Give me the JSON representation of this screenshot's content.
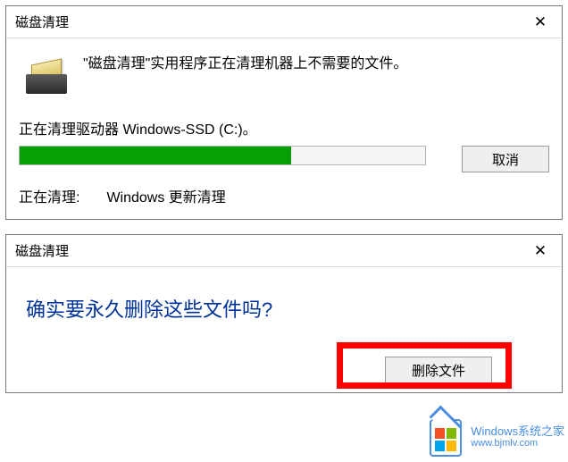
{
  "dialog1": {
    "title": "磁盘清理",
    "close_symbol": "✕",
    "message": "\"磁盘清理\"实用程序正在清理机器上不需要的文件。",
    "status_label": "正在清理驱动器 Windows-SSD (C:)。",
    "progress_percent": 67,
    "cancel_label": "取消",
    "detail_prefix": "正在清理:",
    "detail_value": "Windows 更新清理"
  },
  "dialog2": {
    "title": "磁盘清理",
    "close_symbol": "✕",
    "question": "确实要永久删除这些文件吗?",
    "delete_label": "删除文件"
  },
  "watermark": {
    "brand": "Windows系统之家",
    "url": "www.bjmlv.com"
  }
}
